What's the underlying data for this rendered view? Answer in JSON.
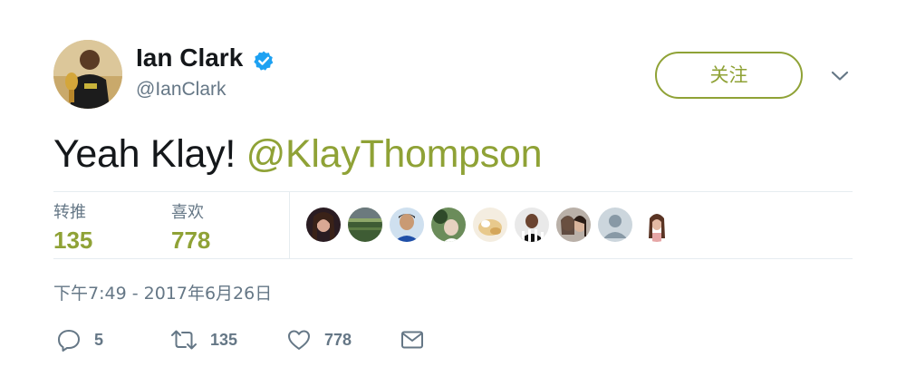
{
  "author": {
    "name": "Ian Clark",
    "handle": "@IanClark",
    "verified": true
  },
  "follow_button": {
    "label": "关注"
  },
  "tweet": {
    "text": "Yeah Klay! ",
    "mention": "@KlayThompson"
  },
  "stats": {
    "retweets": {
      "label": "转推",
      "value": "135"
    },
    "likes": {
      "label": "喜欢",
      "value": "778"
    }
  },
  "timestamp": "下午7:49 - 2017年6月26日",
  "actions": {
    "reply_count": "5",
    "retweet_count": "135",
    "like_count": "778"
  },
  "colors": {
    "accent": "#8fa236",
    "text": "#14171a",
    "secondary": "#657786",
    "verified": "#1da1f2",
    "divider": "#e6ecf0"
  },
  "icons": {
    "verified": "verified-badge-icon",
    "menu": "chevron-down-icon",
    "reply": "reply-icon",
    "retweet": "retweet-icon",
    "like": "heart-icon",
    "message": "envelope-icon"
  }
}
